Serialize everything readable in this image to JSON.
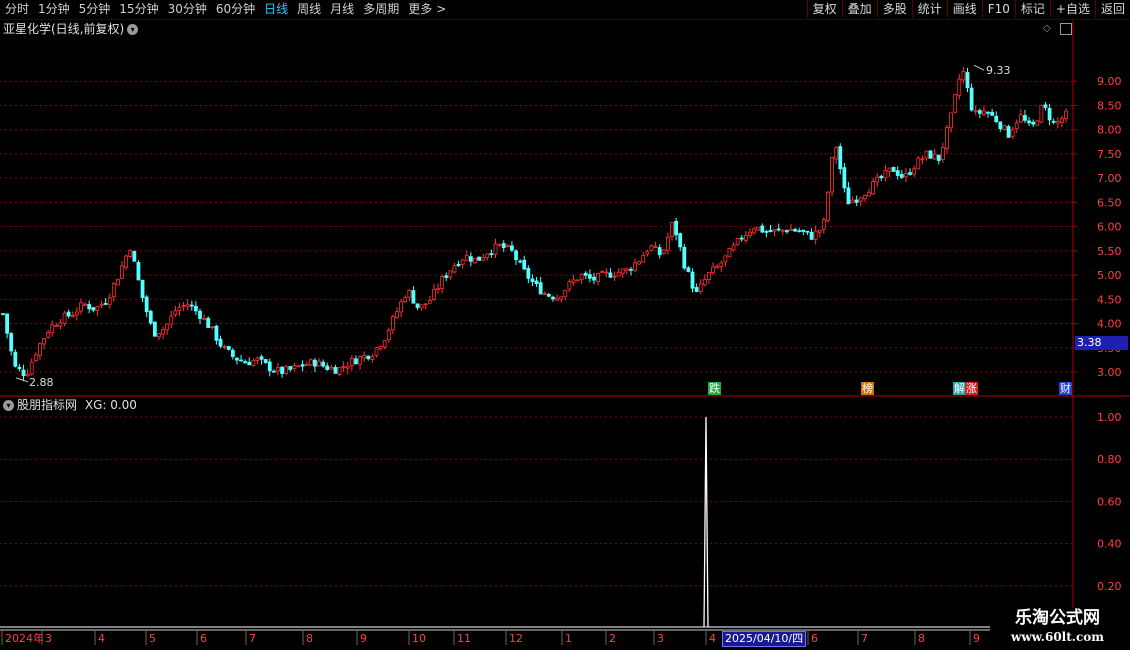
{
  "toolbar": {
    "periods": [
      "分时",
      "1分钟",
      "5分钟",
      "15分钟",
      "30分钟",
      "60分钟",
      "日线",
      "周线",
      "月线",
      "多周期",
      "更多"
    ],
    "active_period": "日线",
    "more_icon": "chevron-right-icon",
    "right_buttons": [
      "复权",
      "叠加",
      "多股",
      "统计",
      "画线",
      "F10",
      "标记",
      "+自选",
      "返回"
    ]
  },
  "main_panel": {
    "title": "亚星化学(日线,前复权)",
    "high_label": "9.33",
    "low_label": "2.88",
    "current_price": "3.38",
    "badges": [
      {
        "text": "跌",
        "color": "#22aa44"
      },
      {
        "text": "榜",
        "color": "#cc7700"
      },
      {
        "text": "解",
        "color": "#22aaaa"
      },
      {
        "text": "涨",
        "color": "#cc2222"
      },
      {
        "text": "财",
        "color": "#2244cc"
      }
    ]
  },
  "indicator_panel": {
    "title": "股朋指标网",
    "value_label": "XG: 0.00"
  },
  "time_axis": {
    "selected_date": "2025/04/10/四"
  },
  "watermark": {
    "line1": "乐淘公式网",
    "line2": "www.60lt.com"
  },
  "chart_data": [
    {
      "type": "candlestick",
      "title": "亚星化学(日线,前复权)",
      "y_ticks": [
        "9.00",
        "8.50",
        "8.00",
        "7.50",
        "7.00",
        "6.50",
        "6.00",
        "5.50",
        "5.00",
        "4.50",
        "4.00",
        "3.50",
        "3.00"
      ],
      "ylim": [
        2.75,
        9.55
      ],
      "x_ticks": [
        "2024年",
        "3",
        "4",
        "5",
        "6",
        "7",
        "8",
        "9",
        "10",
        "11",
        "12",
        "1",
        "2",
        "3",
        "4",
        "5",
        "6",
        "7",
        "8",
        "9"
      ],
      "grid": true,
      "trend_closes": [
        4.2,
        3.1,
        2.95,
        3.5,
        3.9,
        4.1,
        4.2,
        4.4,
        4.3,
        4.5,
        5.0,
        5.6,
        4.6,
        3.8,
        3.9,
        4.3,
        4.4,
        4.2,
        3.9,
        3.5,
        3.3,
        3.2,
        3.25,
        3.1,
        3.0,
        3.05,
        3.15,
        3.2,
        3.1,
        3.05,
        3.2,
        3.3,
        3.4,
        3.7,
        4.2,
        4.7,
        4.3,
        4.5,
        4.9,
        5.2,
        5.4,
        5.3,
        5.5,
        5.6,
        5.5,
        5.1,
        4.8,
        4.6,
        4.55,
        4.8,
        5.0,
        4.9,
        5.0,
        5.05,
        5.1,
        5.3,
        5.6,
        5.4,
        6.1,
        5.2,
        4.6,
        5.0,
        5.2,
        5.5,
        5.8,
        6.0,
        5.9,
        5.9,
        5.95,
        5.9,
        5.8,
        6.0,
        7.8,
        6.5,
        6.6,
        6.8,
        7.0,
        7.2,
        7.0,
        7.3,
        7.5,
        7.4,
        8.2,
        9.3,
        8.3,
        8.4,
        8.2,
        7.9,
        8.3,
        8.0,
        8.5,
        8.1,
        8.3
      ],
      "high": 9.33,
      "low": 2.88,
      "current": 3.38
    },
    {
      "type": "line",
      "title": "股朋指标网",
      "series": [
        {
          "name": "XG",
          "value": 0.0
        }
      ],
      "y_ticks": [
        "1.00",
        "0.80",
        "0.60",
        "0.40",
        "0.20"
      ],
      "ylim": [
        0,
        1.1
      ],
      "spike_x": "2025/04/10",
      "spike_value": 1.0
    }
  ]
}
